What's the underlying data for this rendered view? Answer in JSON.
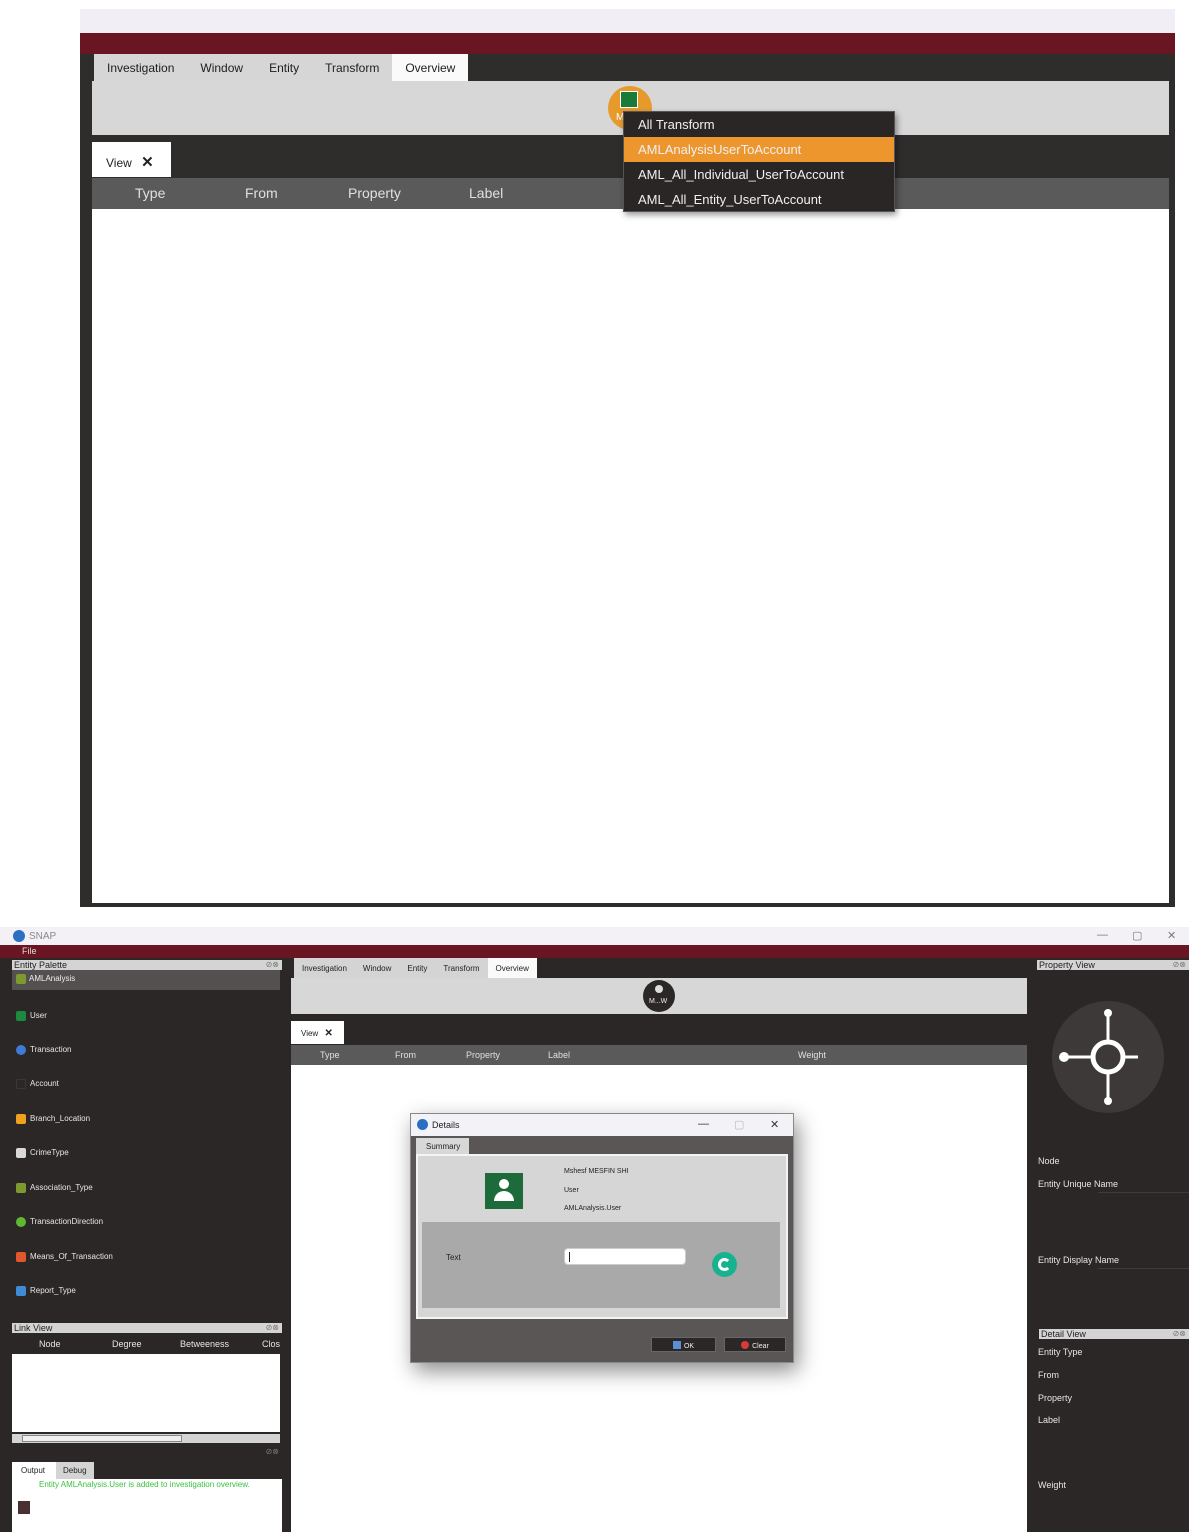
{
  "top_panel": {
    "tabs": [
      {
        "label": "Investigation"
      },
      {
        "label": "Window"
      },
      {
        "label": "Entity"
      },
      {
        "label": "Transform"
      },
      {
        "label": "Overview",
        "active": true
      }
    ],
    "view_tab": {
      "label": "View",
      "close": "✕"
    },
    "columns": [
      "Type",
      "From",
      "Property",
      "Label"
    ],
    "node_label": "M",
    "context_menu": {
      "items": [
        {
          "label": "All Transform"
        },
        {
          "label": "AMLAnalysisUserToAccount",
          "selected": true
        },
        {
          "label": "AML_All_Individual_UserToAccount"
        },
        {
          "label": "AML_All_Entity_UserToAccount"
        }
      ],
      "highlight_color": "#ee962e"
    }
  },
  "window": {
    "title": "SNAP",
    "controls": {
      "minimize": "—",
      "maximize": "▢",
      "close": "✕"
    },
    "menu": {
      "file": "File"
    },
    "entity_palette": {
      "title": "Entity Palette",
      "group": "AMLAnalysis",
      "items": [
        {
          "label": "User",
          "icon": "user-icon",
          "color": "#1c8a3e"
        },
        {
          "label": "Transaction",
          "icon": "transaction-icon",
          "color": "#3d7bd6"
        },
        {
          "label": "Account",
          "icon": "account-icon",
          "color": "#2b2727"
        },
        {
          "label": "Branch_Location",
          "icon": "branch-icon",
          "color": "#f0a21c"
        },
        {
          "label": "CrimeType",
          "icon": "crime-icon",
          "color": "#d9d9d9"
        },
        {
          "label": "Association_Type",
          "icon": "association-icon",
          "color": "#7c9a2e"
        },
        {
          "label": "TransactionDirection",
          "icon": "direction-icon",
          "color": "#5fb832"
        },
        {
          "label": "Means_Of_Transaction",
          "icon": "means-icon",
          "color": "#e0582c"
        },
        {
          "label": "Report_Type",
          "icon": "report-icon",
          "color": "#3f8cd4"
        }
      ]
    },
    "link_view": {
      "title": "Link View",
      "columns": [
        "Node",
        "Degree",
        "Betweeness",
        "Clos"
      ]
    },
    "output": {
      "tabs": [
        "Output",
        "Debug"
      ],
      "message": "Entity AMLAnalysis.User is added to investigation overview."
    },
    "center": {
      "tabs": [
        {
          "label": "Investigation"
        },
        {
          "label": "Window"
        },
        {
          "label": "Entity"
        },
        {
          "label": "Transform"
        },
        {
          "label": "Overview",
          "active": true
        }
      ],
      "node_label": "M...W",
      "view_tab": {
        "label": "View",
        "close": "✕"
      },
      "columns": [
        "Type",
        "From",
        "Property",
        "Label",
        "Weight"
      ]
    },
    "dialog": {
      "title": "Details",
      "controls": {
        "minimize": "—",
        "maximize": "▢",
        "close": "✕"
      },
      "tab": "Summary",
      "name": "Mshesf MESFIN SHI",
      "type": "User",
      "entity": "AMLAnalysis.User",
      "field_label": "Text",
      "field_value": "",
      "ok_label": "OK",
      "clear_label": "Clear"
    },
    "property_view": {
      "title": "Property View",
      "labels": [
        "Node",
        "Entity Unique Name",
        "Entity Display Name"
      ]
    },
    "detail_view": {
      "title": "Detail View",
      "labels": [
        "Entity Type",
        "From",
        "Property",
        "Label",
        "Weight"
      ]
    },
    "colors": {
      "maroon": "#6a1522",
      "dark_bg": "#2b2727",
      "accent": "#ee962e",
      "output_text": "#39c13e"
    }
  }
}
